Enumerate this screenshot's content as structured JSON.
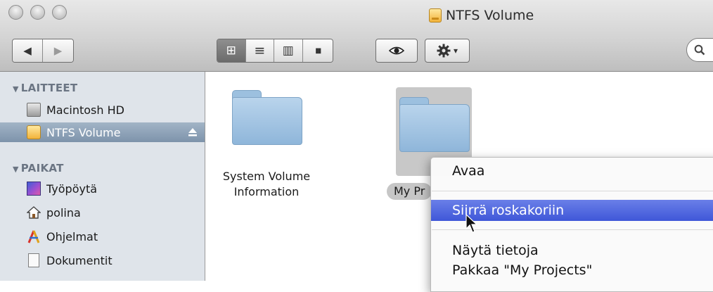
{
  "window": {
    "title": "NTFS Volume"
  },
  "toolbar": {
    "back_label": "◀",
    "forward_label": "▶",
    "view_icons": "⊞",
    "view_list": "≡",
    "view_columns": "▥",
    "view_coverflow": "▮▮",
    "quicklook_icon": "eye-icon",
    "action_icon": "gear-icon",
    "action_caret": "▾"
  },
  "sidebar": {
    "devices_header": "LAITTEET",
    "places_header": "PAIKAT",
    "devices": [
      {
        "label": "Macintosh HD",
        "icon": "hard-drive-icon"
      },
      {
        "label": "NTFS Volume",
        "icon": "ntfs-volume-icon",
        "selected": true
      }
    ],
    "places": [
      {
        "label": "Työpöytä",
        "icon": "desktop-icon"
      },
      {
        "label": "polina",
        "icon": "home-icon"
      },
      {
        "label": "Ohjelmat",
        "icon": "applications-icon"
      },
      {
        "label": "Dokumentit",
        "icon": "documents-icon"
      }
    ]
  },
  "content": {
    "items": [
      {
        "line1": "System Volume",
        "line2": "Information",
        "selected": false
      },
      {
        "label": "My Pr",
        "selected": true
      }
    ]
  },
  "context_menu": {
    "items": [
      {
        "label": "Avaa"
      },
      {
        "label": "Siirrä roskakoriin",
        "highlighted": true
      },
      {
        "label": "Näytä tietoja"
      },
      {
        "label": "Pakkaa \"My Projects\""
      }
    ]
  },
  "colors": {
    "selection_blue": "#3f57d8",
    "sidebar_bg": "#dfe4ea",
    "folder_blue": "#9cc0df"
  }
}
